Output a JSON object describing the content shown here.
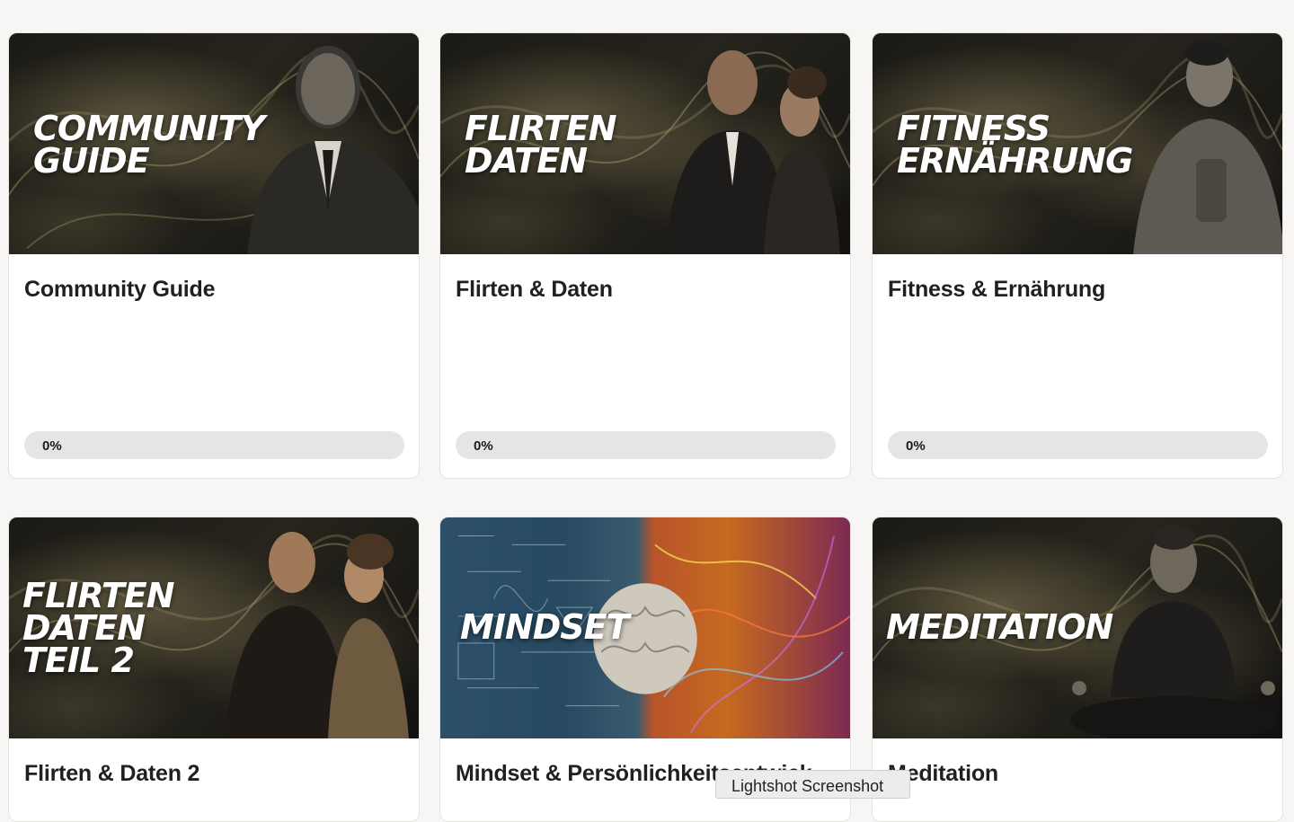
{
  "courses": [
    {
      "thumb_title": "COMMUNITY\nGUIDE",
      "title": "Community Guide",
      "progress": "0%",
      "progress_value": 0
    },
    {
      "thumb_title": "FLIRTEN\nDATEN",
      "title": "Flirten & Daten",
      "progress": "0%",
      "progress_value": 0
    },
    {
      "thumb_title": "FITNESS\nERNÄHRUNG",
      "title": "Fitness & Ernährung",
      "progress": "0%",
      "progress_value": 0
    },
    {
      "thumb_title": "FLIRTEN\nDATEN\nTEIL 2",
      "title": "Flirten & Daten 2"
    },
    {
      "thumb_title": "MINDSET",
      "title": "Mindset & Persönlichkeitsentwick"
    },
    {
      "thumb_title": "MEDITATION",
      "title": "Meditation"
    }
  ],
  "tooltip": "Lightshot Screenshot",
  "colors": {
    "page_background": "#f7f6f4",
    "card_background": "#ffffff",
    "progress_track": "#e5e5e5",
    "title_text": "#202020"
  }
}
